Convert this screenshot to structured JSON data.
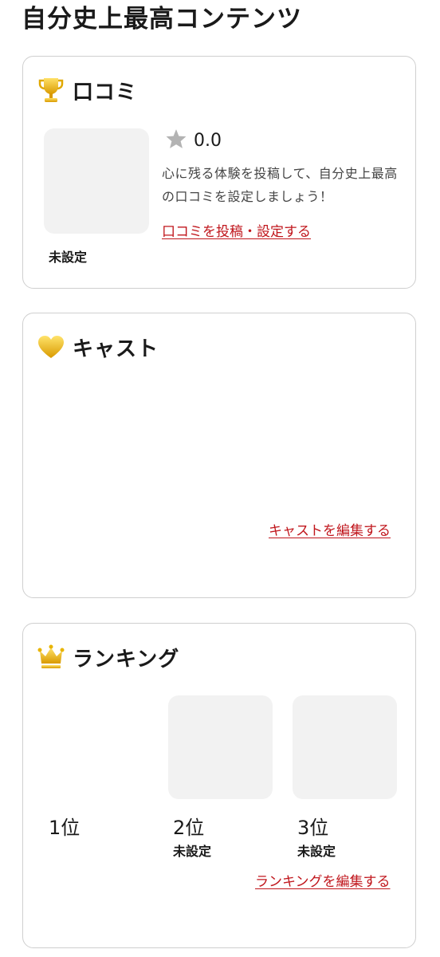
{
  "page": {
    "title": "自分史上最高コンテンツ"
  },
  "review": {
    "heading": "口コミ",
    "icon": "trophy-icon",
    "rating_value": "0.0",
    "description": "心に残る体験を投稿して、自分史上最高の口コミを設定しましょう！",
    "unset_label": "未設定",
    "action_link": "口コミを投稿・設定する"
  },
  "cast": {
    "heading": "キャスト",
    "icon": "heart-icon",
    "action_link": "キャストを編集する"
  },
  "ranking": {
    "heading": "ランキング",
    "icon": "crown-icon",
    "items": [
      {
        "rank": "1位",
        "status": ""
      },
      {
        "rank": "2位",
        "status": "未設定"
      },
      {
        "rank": "3位",
        "status": "未設定"
      }
    ],
    "action_link": "ランキングを編集する"
  },
  "colors": {
    "link": "#c0161c",
    "gold": "#e8b400",
    "placeholder": "#f2f2f2",
    "border": "#cfcfcf"
  }
}
